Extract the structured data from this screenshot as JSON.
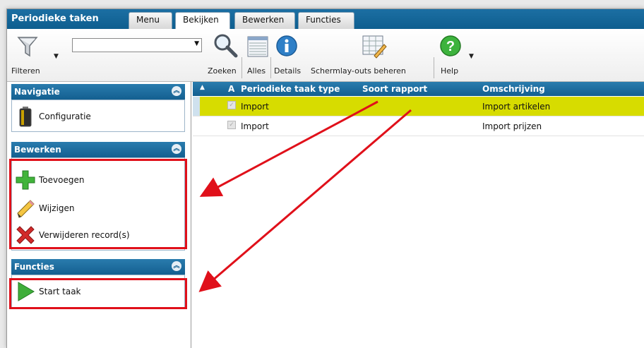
{
  "app": {
    "title": "Periodieke taken"
  },
  "tabs": [
    {
      "label": "Menu"
    },
    {
      "label": "Bekijken",
      "active": true
    },
    {
      "label": "Bewerken"
    },
    {
      "label": "Functies"
    }
  ],
  "toolbar": {
    "filter_label": "Filteren",
    "search_value": "",
    "search_label": "Zoeken",
    "all_label": "Alles",
    "details_label": "Details",
    "layouts_label": "Schermlay-outs beheren",
    "help_label": "Help"
  },
  "sidebar": {
    "navigation": {
      "title": "Navigatie",
      "items": [
        {
          "label": "Configuratie",
          "icon": "battery-icon"
        }
      ]
    },
    "edit": {
      "title": "Bewerken",
      "items": [
        {
          "label": "Toevoegen",
          "icon": "plus-icon"
        },
        {
          "label": "Wijzigen",
          "icon": "pencil-icon"
        },
        {
          "label": "Verwijderen record(s)",
          "icon": "delete-icon"
        }
      ]
    },
    "functions": {
      "title": "Functies",
      "items": [
        {
          "label": "Start taak",
          "icon": "play-icon"
        }
      ]
    }
  },
  "grid": {
    "columns": [
      "A",
      "Periodieke taak type",
      "Soort rapport",
      "Omschrijving"
    ],
    "rows": [
      {
        "active": true,
        "type": "Import",
        "report": "",
        "description": "Import artikelen",
        "selected": true
      },
      {
        "active": true,
        "type": "Import",
        "report": "",
        "description": "Import prijzen",
        "selected": false
      }
    ]
  },
  "colors": {
    "header_blue": "#135f90",
    "selection_yellow": "#d7dc00",
    "annotation_red": "#e0101a"
  }
}
